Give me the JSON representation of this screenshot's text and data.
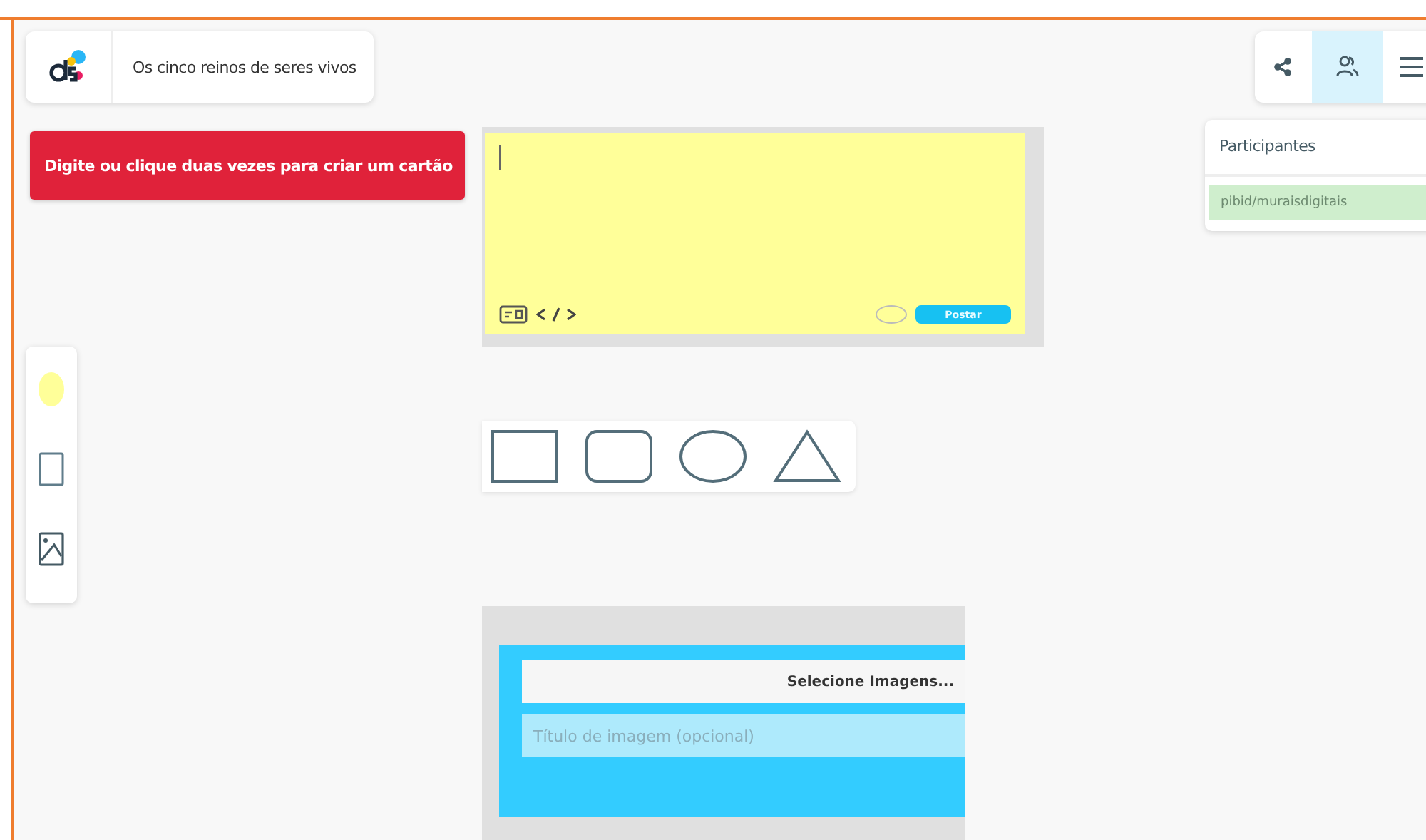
{
  "header": {
    "title": "Os cinco reinos de seres vivos"
  },
  "toast": {
    "message": "Digite ou clique duas vezes para criar um cartão"
  },
  "toolbar": {
    "buttons": [
      {
        "kind": "share",
        "selected": false
      },
      {
        "kind": "participants",
        "selected": true
      },
      {
        "kind": "menu",
        "selected": false
      }
    ]
  },
  "participants": {
    "title": "Participantes",
    "items": [
      {
        "name": "pibid/muraisdigitais"
      }
    ]
  },
  "tools": [
    {
      "kind": "color",
      "color": "#ffff99"
    },
    {
      "kind": "card"
    },
    {
      "kind": "image"
    }
  ],
  "note": {
    "submit_label": "Postar"
  },
  "shapes": [
    {
      "kind": "rectangle"
    },
    {
      "kind": "rounded"
    },
    {
      "kind": "ellipse"
    },
    {
      "kind": "triangle"
    }
  ],
  "image_card": {
    "button": "Selecione Imagens...",
    "placeholder": "Título de imagem (opcional)"
  }
}
